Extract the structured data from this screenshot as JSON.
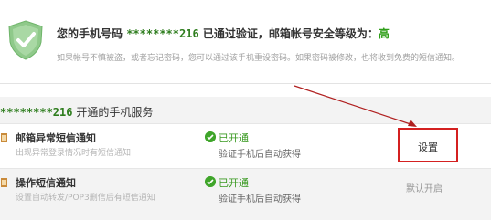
{
  "verify": {
    "prefix": "您的手机号码",
    "phone": "********216",
    "middle": "已通过验证，邮箱帐号安全等级为：",
    "level": "高",
    "hint": "如果帐号不慎被盗，或者忘记密码，您可以通过该手机重设密码。如果密码被修改，也将收到免费的短信通知。"
  },
  "services": {
    "phone": "********216",
    "title": "开通的手机服务",
    "items": [
      {
        "name": "邮箱异常短信通知",
        "desc": "出现异常登录情况时有短信通知",
        "status": "已开通",
        "status_note": "验证手机后自动获得",
        "action": "设置"
      },
      {
        "name": "操作短信通知",
        "desc": "设置自动转发/POP3删信后有短信通知",
        "status": "已开通",
        "status_note": "验证手机后自动获得",
        "action": "默认开启"
      }
    ]
  },
  "colors": {
    "accent_green": "#3a9a22",
    "highlight_red": "#d42020"
  }
}
